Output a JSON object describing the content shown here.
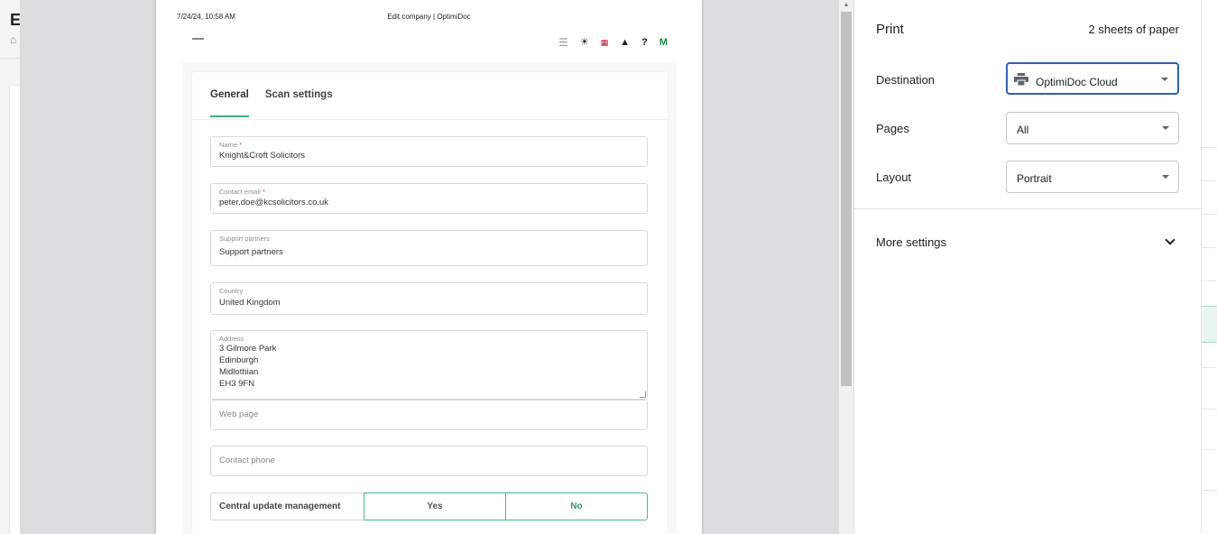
{
  "app": {
    "title_initial": "E"
  },
  "preview": {
    "header_date": "7/24/24, 10:58 AM",
    "header_title": "Edit company | OptimiDoc",
    "user_initial": "M",
    "tabs": [
      {
        "label": "General",
        "active": true
      },
      {
        "label": "Scan settings",
        "active": false
      }
    ],
    "fields": {
      "name": {
        "label": "Name",
        "required_mark": "*",
        "value": "Knight&Croft Solicitors"
      },
      "contact_email": {
        "label": "Contact email",
        "required_mark": "*",
        "value": "peter.doe@kcsolicitors.co.uk"
      },
      "support_partners": {
        "label": "Support partners",
        "value": "Support partners"
      },
      "country": {
        "label": "Country",
        "value": "United Kingdom"
      },
      "address": {
        "label": "Address",
        "lines": [
          "3 Gilmore Park",
          "Edinburgh",
          "Midlothian",
          "EH3 9FN"
        ]
      },
      "web_page": {
        "placeholder": "Web page"
      },
      "contact_phone": {
        "placeholder": "Contact phone"
      }
    },
    "central_update": {
      "label": "Central update management",
      "yes": "Yes",
      "no": "No",
      "selected": "No"
    }
  },
  "print_panel": {
    "title": "Print",
    "sheets": "2 sheets of paper",
    "destination": {
      "label": "Destination",
      "value": "OptimiDoc Cloud",
      "icon": "printer-icon"
    },
    "pages": {
      "label": "Pages",
      "value": "All"
    },
    "layout": {
      "label": "Layout",
      "value": "Portrait"
    },
    "more_settings": "More settings"
  },
  "colors": {
    "accent_green": "#38b47c",
    "focus_blue": "#2b5fc7",
    "required_red": "#e53935"
  }
}
